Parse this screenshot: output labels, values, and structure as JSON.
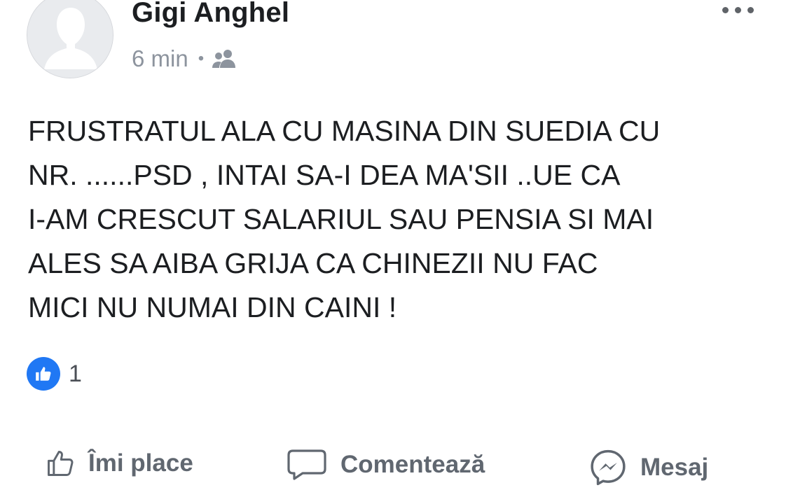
{
  "post": {
    "author": "Gigi Anghel",
    "time": "6 min",
    "separator": "•",
    "privacy_icon": "friends-icon",
    "text_lines": [
      "FRUSTRATUL ALA CU MASINA DIN SUEDIA CU",
      "NR. ......PSD , INTAI SA-I DEA MA'SII ..UE CA",
      "I-AM CRESCUT SALARIUL SAU PENSIA SI MAI",
      "ALES SA AIBA GRIJA CA CHINEZII NU FAC",
      "MICI NU NUMAI DIN CAINI !"
    ]
  },
  "reactions": {
    "icon": "like-icon",
    "count": "1"
  },
  "actions": {
    "like_label": "Îmi place",
    "comment_label": "Comentează",
    "message_label": "Mesaj"
  },
  "colors": {
    "like_blue": "#2078f4",
    "secondary_text": "#8d949e",
    "action_text": "#606770"
  }
}
